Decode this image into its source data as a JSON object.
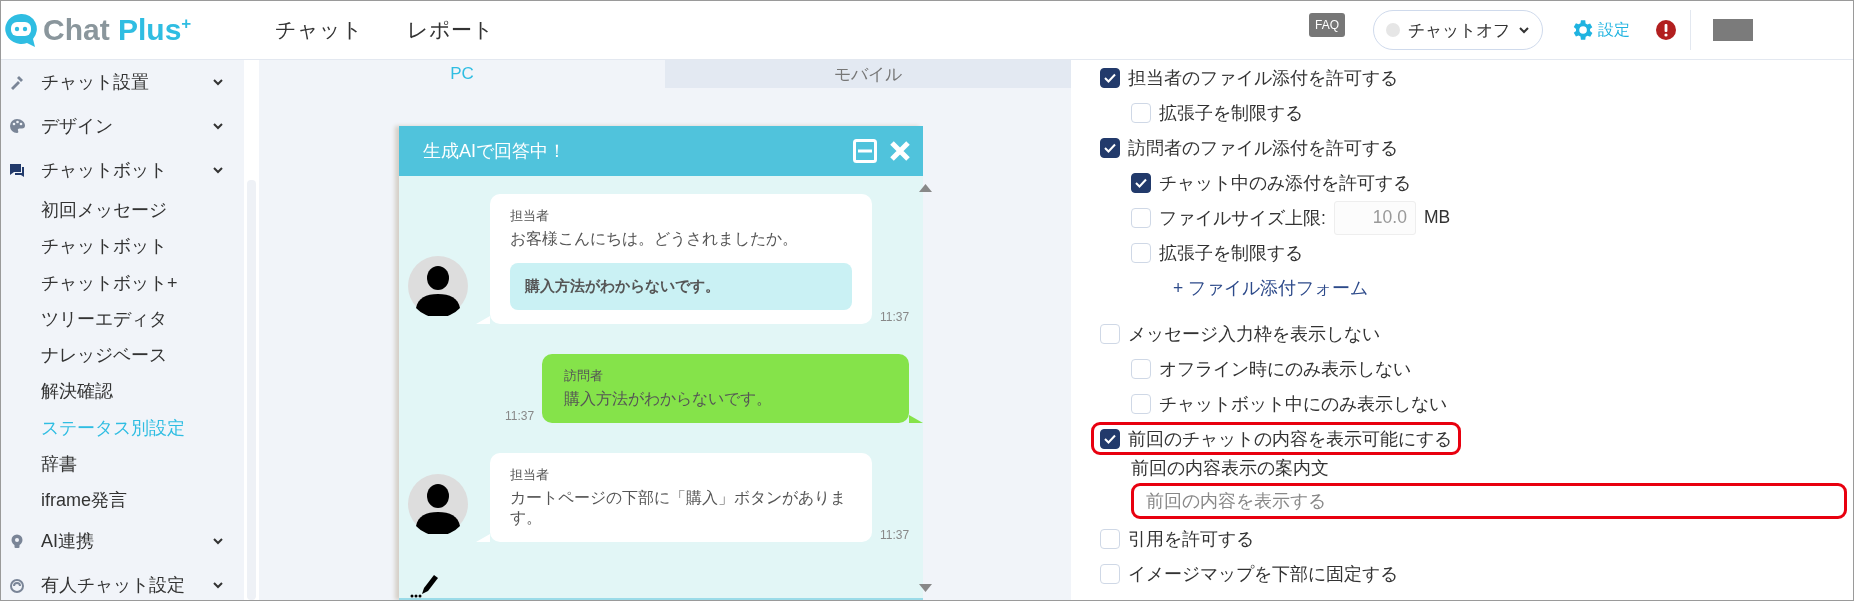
{
  "header": {
    "logo": {
      "text": "Chat",
      "accent": "Plus",
      "sup": "+"
    },
    "nav": [
      {
        "label": "チャット"
      },
      {
        "label": "レポート"
      }
    ],
    "faq": "FAQ",
    "status": {
      "label": "チャットオフ",
      "online": false
    },
    "settings": "設定"
  },
  "sidebar": {
    "items": [
      {
        "label": "チャット設置"
      },
      {
        "label": "デザイン"
      },
      {
        "label": "チャットボット",
        "children": [
          {
            "label": "初回メッセージ",
            "selected": false
          },
          {
            "label": "チャットボット",
            "selected": false
          },
          {
            "label": "チャットボット+",
            "selected": false
          },
          {
            "label": "ツリーエディタ",
            "selected": false
          },
          {
            "label": "ナレッジベース",
            "selected": false
          },
          {
            "label": "解決確認",
            "selected": false
          },
          {
            "label": "ステータス別設定",
            "selected": true
          },
          {
            "label": "辞書",
            "selected": false
          },
          {
            "label": "iframe発言",
            "selected": false
          }
        ]
      },
      {
        "label": "AI連携"
      },
      {
        "label": "有人チャット設定"
      }
    ]
  },
  "preview": {
    "tabs": [
      {
        "label": "PC",
        "selected": true
      },
      {
        "label": "モバイル",
        "selected": false
      }
    ],
    "widget": {
      "title": "生成AIで回答中！",
      "messages": [
        {
          "kind": "agent",
          "name": "担当者",
          "text": "お客様こんにちは。どうされましたか。",
          "quick_reply": "購入方法がわからないです。",
          "time": "11:37"
        },
        {
          "kind": "visitor",
          "name": "訪問者",
          "text": "購入方法がわからないです。",
          "time": "11:37"
        },
        {
          "kind": "agent",
          "name": "担当者",
          "text": "カートページの下部に「購入」ボタンがあります。",
          "time": "11:37"
        }
      ]
    }
  },
  "settings": {
    "options": [
      {
        "kind": "checkbox",
        "label": "担当者のファイル添付を許可する",
        "checked": true,
        "children": [
          {
            "kind": "checkbox",
            "label": "拡張子を制限する",
            "checked": false
          }
        ]
      },
      {
        "kind": "checkbox",
        "label": "訪問者のファイル添付を許可する",
        "checked": true,
        "children": [
          {
            "kind": "checkbox",
            "label": "チャット中のみ添付を許可する",
            "checked": true
          },
          {
            "kind": "checkbox",
            "label": "ファイルサイズ上限:",
            "checked": false,
            "input": {
              "value": "10.0",
              "disabled": true
            },
            "unit": "MB"
          },
          {
            "kind": "checkbox",
            "label": "拡張子を制限する",
            "checked": false
          },
          {
            "kind": "link",
            "label": "+ ファイル添付フォーム"
          }
        ]
      },
      {
        "kind": "checkbox",
        "label": "メッセージ入力枠を表示しない",
        "checked": false,
        "children": [
          {
            "kind": "checkbox",
            "label": "オフライン時にのみ表示しない",
            "checked": false
          },
          {
            "kind": "checkbox",
            "label": "チャットボット中にのみ表示しない",
            "checked": false
          }
        ]
      },
      {
        "kind": "checkbox",
        "label": "前回のチャットの内容を表示可能にする",
        "checked": true,
        "highlighted": true,
        "children": [
          {
            "kind": "field",
            "label": "前回の内容表示の案内文",
            "placeholder": "前回の内容を表示する",
            "highlighted": true
          }
        ]
      },
      {
        "kind": "checkbox",
        "label": "引用を許可する",
        "checked": false
      },
      {
        "kind": "checkbox",
        "label": "イメージマップを下部に固定する",
        "checked": false
      }
    ]
  }
}
